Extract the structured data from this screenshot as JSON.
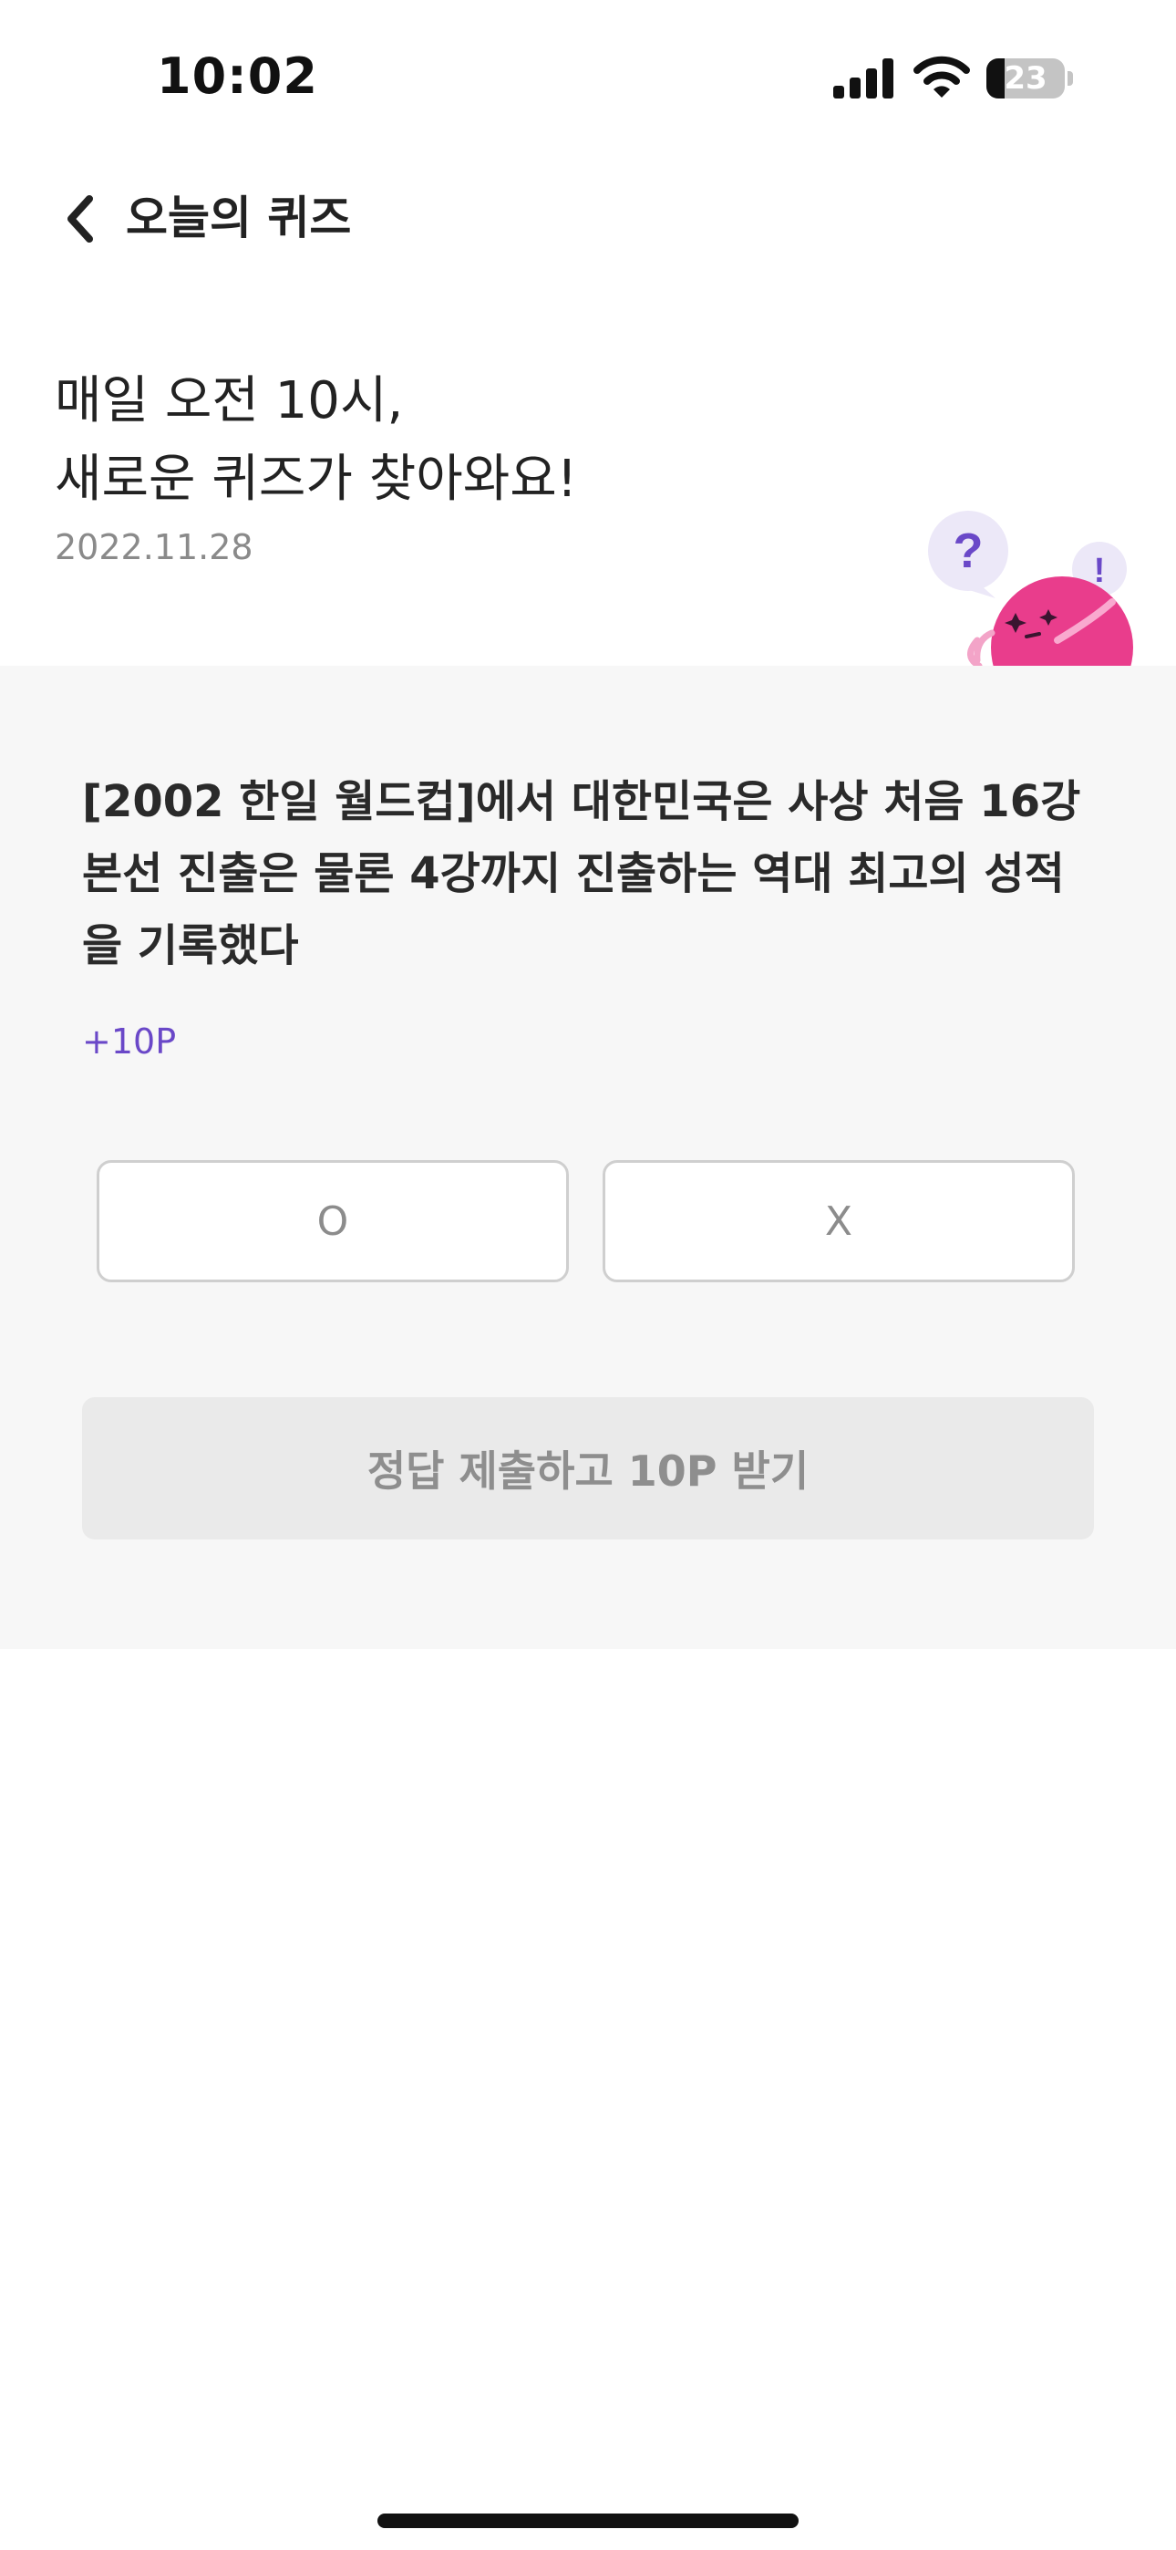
{
  "status_bar": {
    "time": "10:02",
    "battery_level": "23",
    "battery_percent": 23,
    "icons": [
      "signal-icon",
      "wifi-icon",
      "battery-icon"
    ]
  },
  "header": {
    "back_icon": "chevron-left-icon",
    "title": "오늘의 퀴즈"
  },
  "hero": {
    "line1": "매일 오전 10시,",
    "line2": "새로운 퀴즈가 찾아와요!",
    "date": "2022.11.28",
    "mascot_question_mark": "?",
    "mascot_exclamation_mark": "!"
  },
  "quiz": {
    "question_line1": "[2002 한일 월드컵]에서 대한민국은 사상 처음 16강",
    "question_line2": "본선 진출은 물론 4강까지 진출하는 역대 최고의 성적",
    "question_line3": "을 기록했다",
    "reward": "+10P",
    "options": [
      {
        "label": "O"
      },
      {
        "label": "X"
      }
    ],
    "submit_label": "정답 제출하고 10P 받기"
  },
  "colors": {
    "accent": "#6a48c8",
    "quiz_background": "#f7f7f7",
    "submit_disabled": "#eaeaea",
    "mascot_pink": "#e93d8c",
    "bubble": "#ece8f8"
  }
}
